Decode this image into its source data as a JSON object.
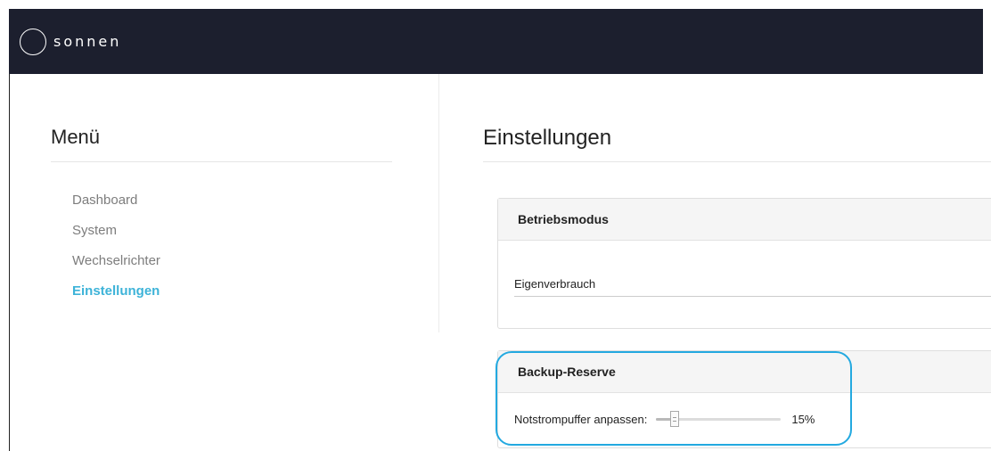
{
  "header": {
    "brand": "sonnen",
    "logo_icon": "sonnen-ring-logo"
  },
  "sidebar": {
    "title": "Menü",
    "items": [
      {
        "label": "Dashboard",
        "active": false
      },
      {
        "label": "System",
        "active": false
      },
      {
        "label": "Wechselrichter",
        "active": false
      },
      {
        "label": "Einstellungen",
        "active": true
      }
    ]
  },
  "main": {
    "title": "Einstellungen",
    "operating_mode": {
      "title": "Betriebsmodus",
      "selected": "Eigenverbrauch"
    },
    "backup_reserve": {
      "title": "Backup-Reserve",
      "label": "Notstrompuffer anpassen:",
      "value_text": "15%",
      "value": 0.15
    }
  },
  "colors": {
    "topbar": "#1c1f2e",
    "active_link": "#3db3d8",
    "highlight": "#23a9e0"
  }
}
